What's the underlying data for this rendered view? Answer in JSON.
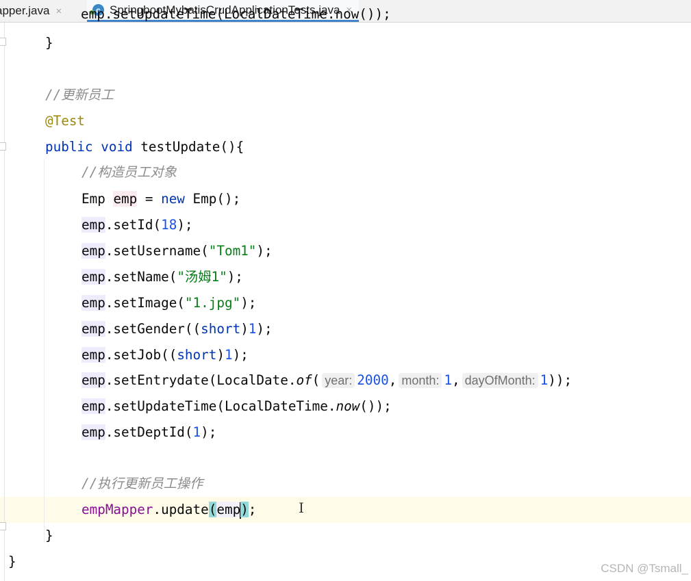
{
  "tabs": [
    {
      "label": "Mapper.java",
      "fragment": "apper.java",
      "close": "×"
    },
    {
      "label": "SpringbootMybatisCrudApplicationTests.java",
      "close": "×",
      "active": true
    }
  ],
  "colors": {
    "keyword": "#0033b3",
    "annotation": "#9e880d",
    "comment": "#8c8c8c",
    "number": "#1750eb",
    "string": "#067d17",
    "active_tab_underline": "#4083c9",
    "caret_row": "#fefbe9"
  },
  "editor": {
    "partial_first_line": "emp.setUpdateTime(LocalDateTime.now());",
    "code": {
      "close_brace_prev": "}",
      "comment_update": "//更新员工",
      "annotation": "@Test",
      "kw_public": "public",
      "kw_void": "void",
      "method_name": "testUpdate",
      "paren_open_brace": "(){",
      "comment_construct": "//构造员工对象",
      "emp_type": "Emp",
      "emp_var": "emp",
      "assign": "=",
      "kw_new": "new",
      "ctor_call": "Emp();",
      "emp_ref": "emp",
      "set_id": ".setId(",
      "id_value": "18",
      "close_semi": ");",
      "set_username": ".setUsername(",
      "username_value": "\"Tom1\"",
      "set_name": ".setName(",
      "name_value": "\"汤姆1\"",
      "set_image": ".setImage(",
      "image_value": "\"1.jpg\"",
      "set_gender": ".setGender((",
      "kw_short": "short",
      "cast_close": ")",
      "gender_value": "1",
      "set_job": ".setJob((",
      "job_value": "1",
      "set_entrydate": ".setEntrydate(LocalDate.",
      "of_method": "of",
      "open_paren": "(",
      "hint_year": "year:",
      "year_value": "2000",
      "comma": ",",
      "hint_month": "month:",
      "month_value": "1",
      "hint_day": "dayOfMonth:",
      "day_value": "1",
      "close_double_semi": "));",
      "set_update_time": ".setUpdateTime(LocalDateTime.",
      "now_method": "now",
      "now_close": "());",
      "set_dept_id": ".setDeptId(",
      "dept_value": "1",
      "comment_execute": "//执行更新员工操作",
      "mapper_field": "empMapper",
      "update_call": ".update",
      "paren_l": "(",
      "arg_emp": "emp",
      "paren_r": ")",
      "semi": ";",
      "close_method": "}",
      "close_class": "}"
    }
  },
  "watermark": "CSDN @Tsmall_"
}
